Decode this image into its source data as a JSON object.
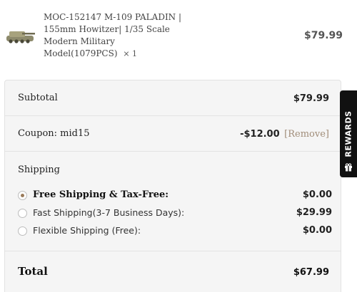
{
  "product": {
    "name": "MOC-152147 M-109 PALADIN | 155mm Howitzer| 1/35 Scale Modern Military Model(1079PCS)",
    "quantity": "× 1",
    "price": "$79.99",
    "thumbnail_icon": "tank-model-thumbnail"
  },
  "summary": {
    "subtotal_label": "Subtotal",
    "subtotal_value": "$79.99",
    "coupon_label": "Coupon: mid15",
    "coupon_value": "-$12.00",
    "coupon_remove": "[Remove]",
    "shipping_label": "Shipping",
    "shipping_options": [
      {
        "label": "Free Shipping & Tax-Free:",
        "price": "$0.00",
        "selected": true
      },
      {
        "label": "Fast Shipping(3-7 Business Days):",
        "price": "$29.99",
        "selected": false
      },
      {
        "label": "Flexible Shipping (Free):",
        "price": "$0.00",
        "selected": false
      }
    ],
    "total_label": "Total",
    "total_value": "$67.99"
  },
  "rewards": {
    "label": "REWARDS",
    "icon": "gift-icon"
  },
  "colors": {
    "accent_radio": "#9a7b5a",
    "remove_link": "#a08c78",
    "rewards_bg": "#111111"
  }
}
